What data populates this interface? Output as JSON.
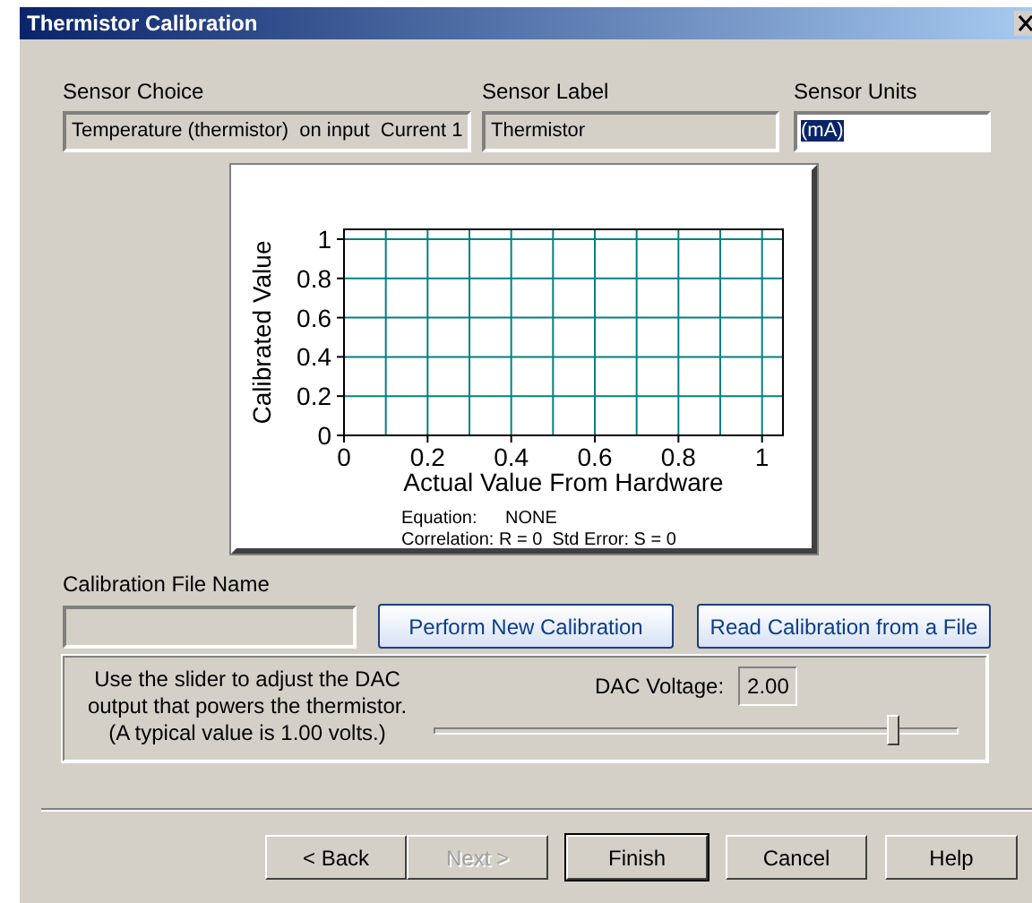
{
  "window": {
    "title": "Thermistor Calibration"
  },
  "sensor_choice": {
    "label": "Sensor Choice",
    "value": "Temperature (thermistor)  on input  Current 1"
  },
  "sensor_label": {
    "label": "Sensor Label",
    "value": "Thermistor"
  },
  "sensor_units": {
    "label": "Sensor Units",
    "value": "(mA)",
    "selected": true
  },
  "chart": {
    "chart_data": {
      "type": "line",
      "grid": true,
      "xlabel": "Actual Value From Hardware",
      "ylabel": "Calibrated Value",
      "xlim": [
        0,
        1.05
      ],
      "ylim": [
        0,
        1.05
      ],
      "xticks": [
        {
          "value": 0,
          "label": "0"
        },
        {
          "value": 0.2,
          "label": "0.2"
        },
        {
          "value": 0.4,
          "label": "0.4"
        },
        {
          "value": 0.6,
          "label": "0.6"
        },
        {
          "value": 0.8,
          "label": "0.8"
        },
        {
          "value": 1,
          "label": "1"
        }
      ],
      "yticks": [
        {
          "value": 0,
          "label": "0"
        },
        {
          "value": 0.2,
          "label": "0.2"
        },
        {
          "value": 0.4,
          "label": "0.4"
        },
        {
          "value": 0.6,
          "label": "0.6"
        },
        {
          "value": 0.8,
          "label": "0.8"
        },
        {
          "value": 1,
          "label": "1"
        }
      ]
    },
    "equation": {
      "label": "Equation:",
      "value": "NONE"
    },
    "statistics": "Correlation: R = 0  Std Error: S = 0"
  },
  "calibration_file": {
    "label": "Calibration File Name"
  },
  "calibration_buttons": [
    "Perform New Calibration",
    "Read Calibration from a File"
  ],
  "dac": {
    "instructions": "Use the slider to adjust the DAC\noutput that powers the thermistor.\n(A typical value is 1.00 volts.)",
    "voltage_label": "DAC Voltage:",
    "voltage_value": "2.00",
    "slider": {
      "level": 0.88
    }
  },
  "wizard_buttons": [
    {
      "label": "< Back",
      "disabled": false,
      "default": false
    },
    {
      "label": "Next >",
      "disabled": true,
      "default": false
    },
    {
      "label": "Finish",
      "disabled": false,
      "default": true
    },
    {
      "label": "Cancel",
      "disabled": false,
      "default": false
    },
    {
      "label": "Help",
      "disabled": false,
      "default": false
    }
  ]
}
